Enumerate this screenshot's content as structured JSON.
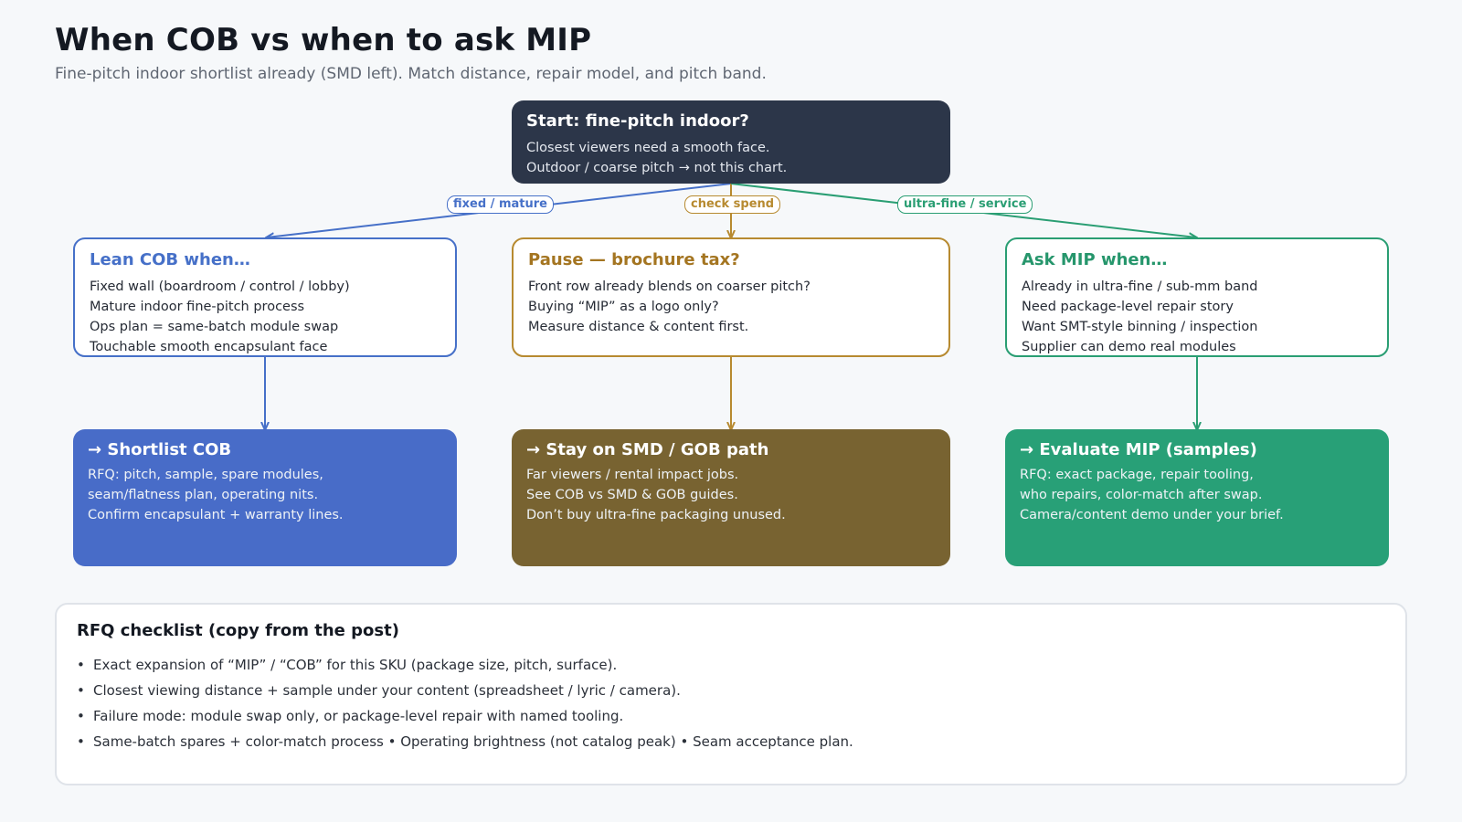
{
  "header": {
    "title": "When COB vs when to ask MIP",
    "subtitle": "Fine-pitch indoor shortlist already (SMD left). Match distance, repair model, and pitch band."
  },
  "start": {
    "title": "Start: fine-pitch indoor?",
    "lines": [
      "Closest viewers need a smooth face.",
      "Outdoor / coarse pitch → not this chart."
    ]
  },
  "edges": {
    "left": "fixed / mature",
    "center": "check spend",
    "right": "ultra-fine / service"
  },
  "decisions": {
    "cob": {
      "title": "Lean COB when…",
      "lines": [
        "Fixed wall (boardroom / control / lobby)",
        "Mature indoor fine-pitch process",
        "Ops plan = same-batch module swap",
        "Touchable smooth encapsulant face"
      ]
    },
    "pause": {
      "title": "Pause — brochure tax?",
      "lines": [
        "Front row already blends on coarser pitch?",
        "Buying “MIP” as a logo only?",
        "Measure distance & content first."
      ]
    },
    "mip": {
      "title": "Ask MIP when…",
      "lines": [
        "Already in ultra-fine / sub-mm band",
        "Need package-level repair story",
        "Want SMT-style binning / inspection",
        "Supplier can demo real modules"
      ]
    }
  },
  "outcomes": {
    "cob": {
      "title": "→ Shortlist COB",
      "lines": [
        "RFQ: pitch, sample, spare modules,",
        "seam/flatness plan, operating nits.",
        "Confirm encapsulant + warranty lines."
      ]
    },
    "smd": {
      "title": "→ Stay on SMD / GOB path",
      "lines": [
        "Far viewers / rental impact jobs.",
        "See COB vs SMD & GOB guides.",
        "Don’t buy ultra-fine packaging unused."
      ]
    },
    "mip": {
      "title": "→ Evaluate MIP (samples)",
      "lines": [
        "RFQ: exact package, repair tooling,",
        "who repairs, color-match after swap.",
        "Camera/content demo under your brief."
      ]
    }
  },
  "checklist": {
    "title": "RFQ checklist (copy from the post)",
    "bullet": "•",
    "items": [
      "Exact expansion of “MIP” / “COB” for this SKU (package size, pitch, surface).",
      "Closest viewing distance + sample under your content (spreadsheet / lyric / camera).",
      "Failure mode: module swap only, or package-level repair with named tooling.",
      "Same-batch spares + color-match process • Operating brightness (not catalog peak) • Seam acceptance plan."
    ]
  },
  "colors": {
    "start": "#2c3649",
    "cob": "#4670c8",
    "pause": "#b78a30",
    "mip": "#2a9e73",
    "smd_fill": "#786331"
  }
}
